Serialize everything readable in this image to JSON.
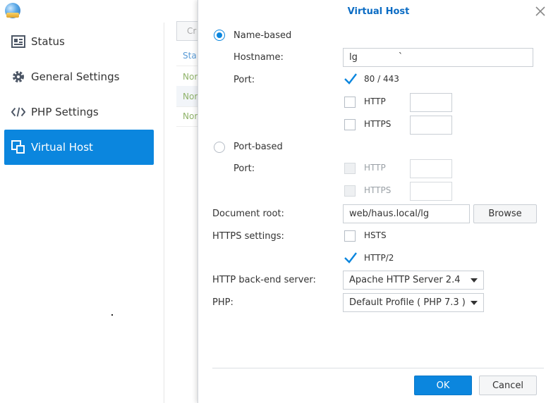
{
  "sidebar": {
    "items": [
      {
        "label": "Status",
        "icon": "status-card-icon",
        "active": false
      },
      {
        "label": "General Settings",
        "icon": "gear-icon",
        "active": false
      },
      {
        "label": "PHP Settings",
        "icon": "code-icon",
        "active": false
      },
      {
        "label": "Virtual Host",
        "icon": "virtual-host-icon",
        "active": true
      }
    ]
  },
  "background_list": {
    "create_label": "Cr",
    "header": "Sta",
    "rows": [
      "Nor",
      "Nor",
      "Nor"
    ]
  },
  "dialog": {
    "title": "Virtual Host",
    "name_based_label": "Name-based",
    "hostname_label": "Hostname:",
    "hostname_value": "lg              `",
    "port_label": "Port:",
    "port_80_443_label": "80 / 443",
    "http_label": "HTTP",
    "https_label": "HTTPS",
    "port_based_label": "Port-based",
    "port_based_port_label": "Port:",
    "document_root_label": "Document root:",
    "document_root_value": "web/haus.local/lg",
    "browse_label": "Browse",
    "https_settings_label": "HTTPS settings:",
    "hsts_label": "HSTS",
    "http2_label": "HTTP/2",
    "backend_label": "HTTP back-end server:",
    "backend_value": "Apache HTTP Server 2.4",
    "php_label": "PHP:",
    "php_value": "Default Profile ( PHP 7.3 )",
    "ok_label": "OK",
    "cancel_label": "Cancel"
  },
  "colors": {
    "accent": "#0b86de",
    "title": "#0b6cc4"
  }
}
